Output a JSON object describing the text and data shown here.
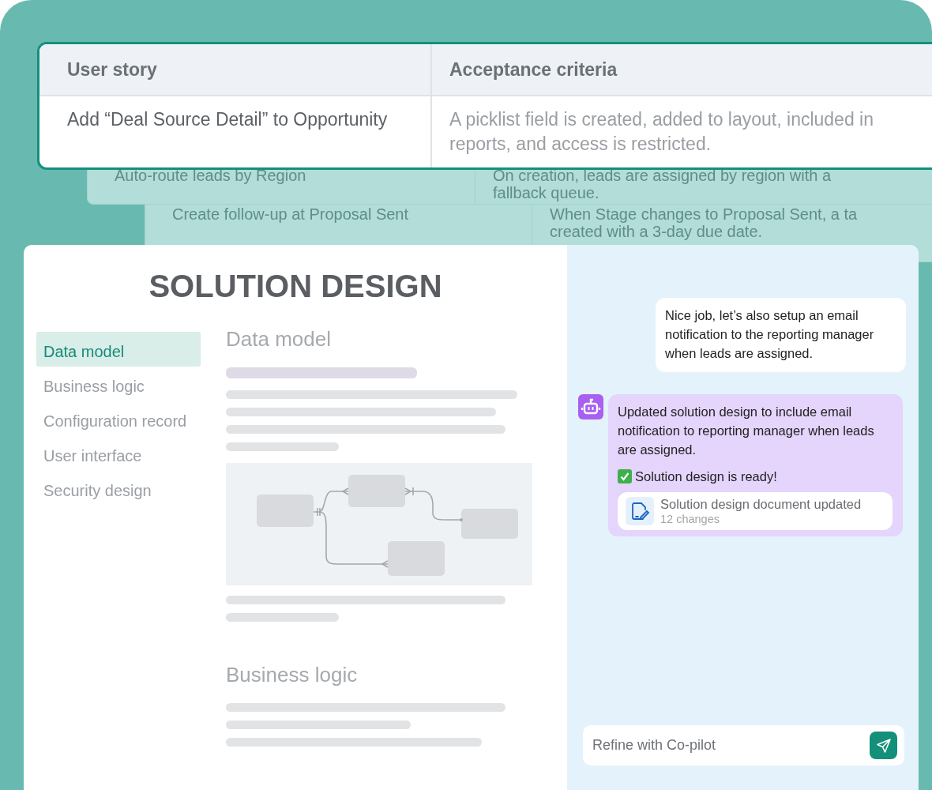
{
  "back_cards": [
    {
      "user_story": "Auto-route leads by Region",
      "criteria_lines": [
        "On creation, leads are assigned by region with a",
        "fallback queue."
      ]
    },
    {
      "user_story": "Create follow-up at Proposal Sent",
      "criteria_lines": [
        "When Stage changes to Proposal Sent, a ta",
        "created with a 3-day due date."
      ]
    }
  ],
  "story_table": {
    "columns": [
      "User story",
      "Acceptance criteria"
    ],
    "rows": [
      [
        "Add “Deal Source Detail” to Opportunity",
        "A picklist field is created, added to layout, included in reports, and access is restricted."
      ]
    ]
  },
  "document": {
    "title": "SOLUTION DESIGN",
    "nav": [
      {
        "label": "Data model",
        "selected": true
      },
      {
        "label": "Business logic",
        "selected": false
      },
      {
        "label": "Configuration record",
        "selected": false
      },
      {
        "label": "User interface",
        "selected": false
      },
      {
        "label": "Security design",
        "selected": false
      }
    ],
    "sections": [
      {
        "heading": "Data model"
      },
      {
        "heading": "Business logic"
      }
    ]
  },
  "chat": {
    "messages": [
      {
        "kind": "user",
        "text": "Nice job, let’s also setup an email notification to the reporting manager when leads are assigned."
      },
      {
        "kind": "bot",
        "text": "Updated solution design to include email notification to reporting manager when leads are assigned.",
        "status": "Solution design is ready!",
        "attachment": {
          "title": "Solution design document updated",
          "subtitle": "12 changes"
        }
      }
    ],
    "input": {
      "placeholder": "Refine with Co-pilot"
    }
  }
}
